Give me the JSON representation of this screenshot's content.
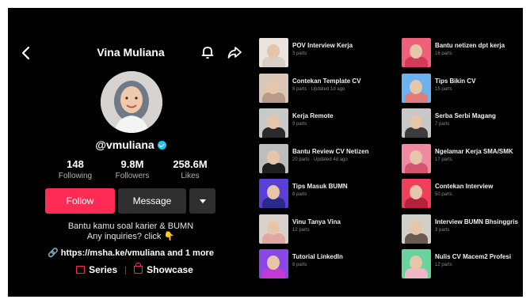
{
  "header": {
    "title": "Vina Muliana"
  },
  "profile": {
    "username": "@vmuliana",
    "stats": [
      {
        "value": "148",
        "label": "Following"
      },
      {
        "value": "9.8M",
        "label": "Followers"
      },
      {
        "value": "258.6M",
        "label": "Likes"
      }
    ],
    "follow_label": "Follow",
    "message_label": "Message",
    "bio_line1": "Bantu kamu soal karier & BUMN",
    "bio_line2": "Any inquiries? click 👇",
    "link_text": "https://msha.ke/vmuliana and 1 more",
    "tab_series": "Series",
    "tab_showcase": "Showcase"
  },
  "series_left": [
    {
      "title": "POV Interview Kerja",
      "sub": "3 parts",
      "bg": "#e9e4de",
      "cloth": "#d8d0c8"
    },
    {
      "title": "Contekan Template CV",
      "sub": "8 parts · Updated 1d ago",
      "bg": "#d9c7b8",
      "cloth": "#b89a86"
    },
    {
      "title": "Kerja Remote",
      "sub": "9 parts",
      "bg": "#c9c9c9",
      "cloth": "#2b2b2b"
    },
    {
      "title": "Bantu Review CV Netizen",
      "sub": "20 parts · Updated 4d ago",
      "bg": "#bdbdbd",
      "cloth": "#1e1e1e"
    },
    {
      "title": "Tips Masuk BUMN",
      "sub": "8 parts",
      "bg": "#5b3fd6",
      "cloth": "#2a2a8c"
    },
    {
      "title": "Vinu Tanya Vina",
      "sub": "12 parts",
      "bg": "#d7d2cb",
      "cloth": "#e3a7a1"
    },
    {
      "title": "Tutorial LinkedIn",
      "sub": "8 parts",
      "bg": "#8a46e6",
      "cloth": "#c23ad1"
    }
  ],
  "series_right": [
    {
      "title": "Bantu netizen dpt kerja",
      "sub": "16 parts",
      "bg": "#f0607a",
      "cloth": "#d33a56"
    },
    {
      "title": "Tips Bikin CV",
      "sub": "15 parts",
      "bg": "#6bb3f0",
      "cloth": "#e37b7b"
    },
    {
      "title": "Serba Serbi Magang",
      "sub": "7 parts",
      "bg": "#c8c8c8",
      "cloth": "#3d3d3d"
    },
    {
      "title": "Ngelamar Kerja SMA/SMK",
      "sub": "17 parts",
      "bg": "#f08aa0",
      "cloth": "#d4556f"
    },
    {
      "title": "Contekan Interview",
      "sub": "50 parts",
      "bg": "#ef3f5b",
      "cloth": "#b3213b"
    },
    {
      "title": "Interview BUMN Bhsinggris",
      "sub": "3 parts",
      "bg": "#d2cfc9",
      "cloth": "#6a5a4f"
    },
    {
      "title": "Nulis CV Macem2 Profesi",
      "sub": "12 parts",
      "bg": "#69d39e",
      "cloth": "#f0b7c8"
    }
  ]
}
